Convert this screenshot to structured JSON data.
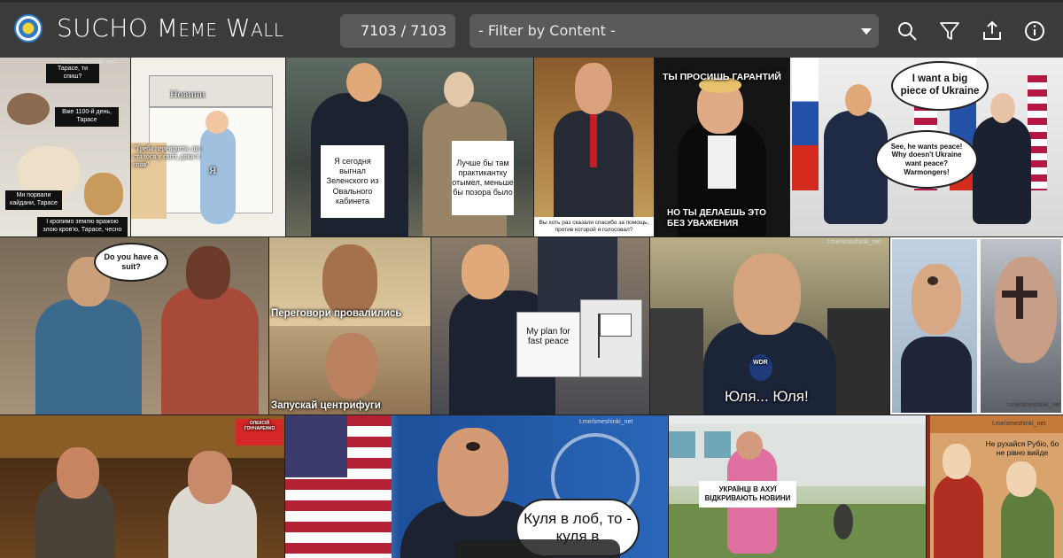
{
  "header": {
    "title": "SUCHO Meme Wall",
    "counter": "7103 / 7103",
    "filter_placeholder": "- Filter by Content -"
  },
  "icons": [
    "search-icon",
    "filter-icon",
    "share-icon",
    "info-icon"
  ],
  "colors": {
    "topbar": "#3b3b3b",
    "control_bg": "#5a5a5a",
    "background": "#1e1e1e"
  },
  "memes": {
    "cats": {
      "line1": "Тарасе, ти спиш?",
      "line2": "Вже 1100-й день, Тарасе",
      "line3": "Ми порвали кайдани, Тарасе",
      "line4": "І кропимо землю вражою злою кров'ю, Тарасе, чесно",
      "watermark": "t.me/smeshinki_net"
    },
    "stove": {
      "label1": "Новини",
      "label2": "\"Треба перевірити, що сталося у світі, доки я спав\"",
      "label3": "Я"
    },
    "trump_melania": {
      "left": "Я сегодня выгнал Зеленского из Овального кабинета",
      "right": "Лучше бы там практикантку отымел, меньше бы позора было"
    },
    "zelensky": {
      "caption": "Вы хоть раз сказали спасибо за помощь, против которой я голосовал?"
    },
    "tux": {
      "top": "ТЫ ПРОСИШЬ ГАРАНТИЙ",
      "bottom": "НО ТЫ ДЕЛАЕШЬ ЭТО БЕЗ УВАЖЕНИЯ"
    },
    "summit": {
      "bubble1": "I want a big piece of Ukraine",
      "bubble2": "See, he wants peace! Why doesn't Ukraine want peace? Warmongers!"
    },
    "suit": {
      "bubble": "Do you have a suit?"
    },
    "centrifuge": {
      "top": "Переговори провалились",
      "bottom": "Запускай центрифуги"
    },
    "plan": {
      "paper": "My plan for fast peace"
    },
    "vance": {
      "caption": "Юля... Юля!",
      "watermark": "t.me/smeshinki_net",
      "mic": "WDR"
    },
    "ash": {
      "watermark": "t.me/smeshinki_net"
    },
    "feast": {
      "badge": "ОЛЕКСІЙ ГОНЧАРЕНКО"
    },
    "rubio": {
      "bubble": "Куля в лоб, то - куля в",
      "watermark": "t.me/smeshinki_net"
    },
    "woman": {
      "caption": "УКРАЇНЦІ В АХУЇ ВІДКРИВАЮТЬ НОВИНИ"
    },
    "medieval": {
      "caption": "Не рухайся Рубіо, бо не рівно вийде",
      "watermark": "t.me/smeshinki_net"
    }
  }
}
